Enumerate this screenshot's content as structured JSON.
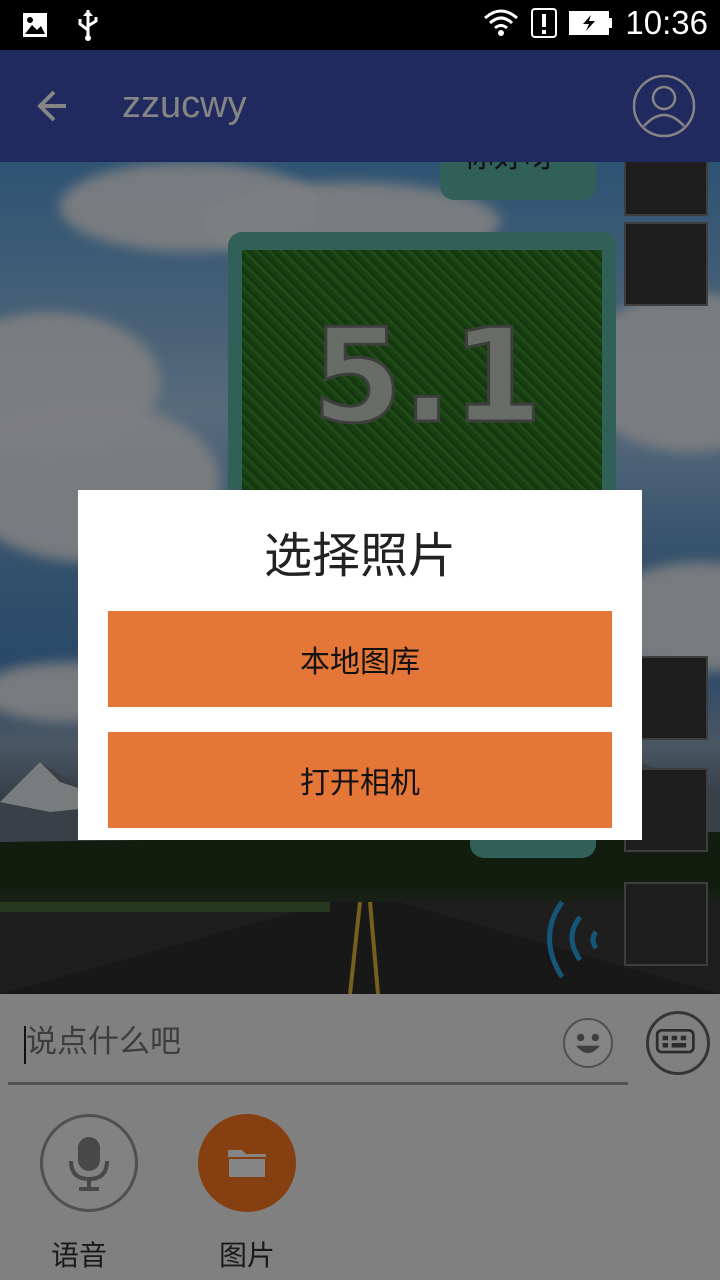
{
  "status_bar": {
    "time": "10:36"
  },
  "app_bar": {
    "title": "zzucwy"
  },
  "chat": {
    "messages": [
      {
        "text": "你好呀"
      },
      {
        "image_caption": "5.1"
      }
    ]
  },
  "dialog": {
    "title": "选择照片",
    "buttons": [
      {
        "label": "本地图库"
      },
      {
        "label": "打开相机"
      }
    ]
  },
  "input": {
    "placeholder": "说点什么吧"
  },
  "toolbar": {
    "voice_label": "语音",
    "photo_label": "图片"
  },
  "colors": {
    "app_bar": "#3f51b5",
    "dialog_button": "#e47638",
    "photo_button": "#ff7a22",
    "bubble": "#5fb9a9"
  },
  "icons": [
    "image-icon",
    "usb-icon",
    "wifi-icon",
    "alert-icon",
    "battery-charging-icon",
    "back-arrow-icon",
    "user-avatar-icon",
    "emoji-icon",
    "keyboard-icon",
    "microphone-icon",
    "folder-icon"
  ]
}
